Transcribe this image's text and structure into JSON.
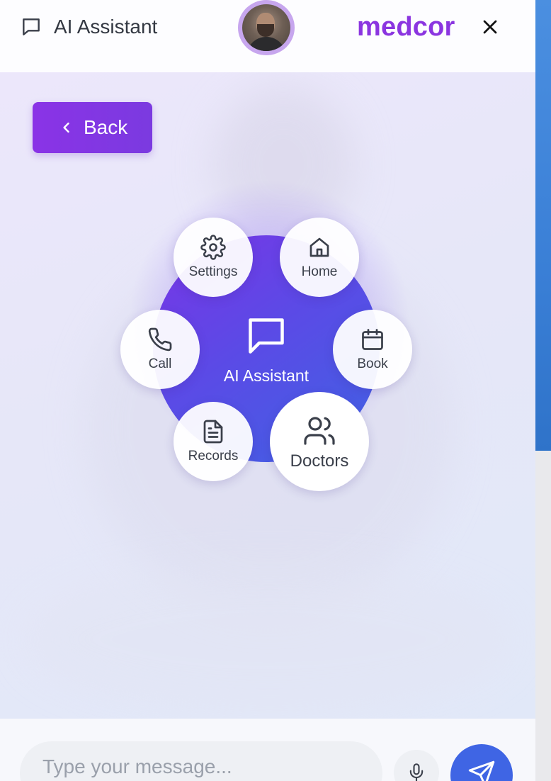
{
  "header": {
    "title": "AI Assistant",
    "brand": "medcor",
    "icons": {
      "chat": "chat-bubble-icon",
      "close": "close-icon"
    }
  },
  "main": {
    "back_label": "Back",
    "hub": {
      "label": "AI Assistant",
      "icon": "chat-bubble-icon"
    },
    "nodes": {
      "settings": {
        "label": "Settings",
        "icon": "gear-icon"
      },
      "home": {
        "label": "Home",
        "icon": "home-icon"
      },
      "call": {
        "label": "Call",
        "icon": "phone-icon"
      },
      "book": {
        "label": "Book",
        "icon": "calendar-icon"
      },
      "records": {
        "label": "Records",
        "icon": "document-icon"
      },
      "doctors": {
        "label": "Doctors",
        "icon": "users-icon"
      }
    }
  },
  "composer": {
    "placeholder": "Type your message...",
    "icons": {
      "mic": "microphone-icon",
      "send": "send-icon"
    }
  },
  "colors": {
    "brand": "#8b35e0",
    "back_button": "#8a33e6",
    "hub_start": "#7a34e6",
    "hub_end": "#3f63e3",
    "send_button": "#3f65e4"
  }
}
